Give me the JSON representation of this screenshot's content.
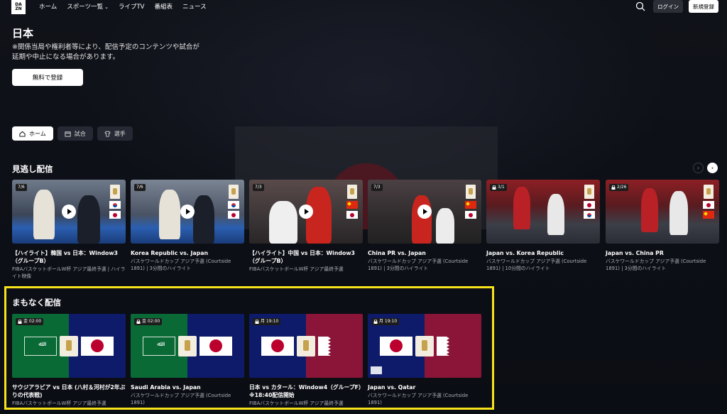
{
  "header": {
    "logo_line1": "DA",
    "logo_line2": "ZN",
    "nav": [
      "ホーム",
      "スポーツ一覧",
      "ライブTV",
      "番組表",
      "ニュース"
    ],
    "login_label": "ログイン",
    "signup_label": "新規登録"
  },
  "page": {
    "title": "日本",
    "notice": "※関係当局や権利者等により、配信予定のコンテンツや試合が延期や中止になる場合があります。",
    "free_signup_label": "無料で登録"
  },
  "tabs": [
    {
      "label": "ホーム",
      "icon": "home-icon",
      "active": true
    },
    {
      "label": "試合",
      "icon": "calendar-icon",
      "active": false
    },
    {
      "label": "選手",
      "icon": "jersey-icon",
      "active": false
    }
  ],
  "catchup": {
    "title": "見逃し配信",
    "cards": [
      {
        "badge": "7/6",
        "title": "【ハイライト】韓国 vs 日本：Window3（グループB）",
        "sub": "FIBAバスケットボールW杯 アジア最終予選 | ハイライト映像",
        "locked": false,
        "play": true
      },
      {
        "badge": "7/6",
        "title": "Korea Republic vs. Japan",
        "sub": "バスケワールドカップ アジア予選 (Courtside 1891) | 3分間のハイライト",
        "locked": false,
        "play": true
      },
      {
        "badge": "7/3",
        "title": "【ハイライト】中国 vs 日本：Window3（グループB）",
        "sub": "FIBAバスケットボールW杯 アジア最終予選",
        "locked": false,
        "play": true
      },
      {
        "badge": "7/3",
        "title": "China PR vs. Japan",
        "sub": "バスケワールドカップ アジア予選 (Courtside 1891) | 3分間のハイライト",
        "locked": false,
        "play": true
      },
      {
        "badge": "3/1",
        "title": "Japan vs. Korea Republic",
        "sub": "バスケワールドカップ アジア予選 (Courtside 1891) | 10分間のハイライト",
        "locked": true,
        "play": false
      },
      {
        "badge": "2/26",
        "title": "Japan vs. China PR",
        "sub": "バスケワールドカップ アジア予選 (Courtside 1891) | 3分間のハイライト",
        "locked": true,
        "play": false
      }
    ]
  },
  "upcoming": {
    "title": "まもなく配信",
    "cards": [
      {
        "badge": "金 02:00",
        "title": "サウジアラビア vs 日本 (八村＆河村が2年ぶりの代表戦)",
        "sub": "FIBAバスケットボールW杯 アジア最終予選"
      },
      {
        "badge": "金 02:00",
        "title": "Saudi Arabia vs. Japan",
        "sub": "バスケワールドカップ アジア予選 (Courtside 1891)"
      },
      {
        "badge": "月 19:10",
        "title": "日本 vs カタール：Window4（グループF）※18:40配信開始",
        "sub": "FIBAバスケットボールW杯 アジア最終予選"
      },
      {
        "badge": "月 19:10",
        "title": "Japan vs. Qatar",
        "sub": "バスケワールドカップ アジア予選 (Courtside 1891)"
      }
    ]
  },
  "colors": {
    "accent_highlight": "#f7e21b",
    "japan_red": "#bc002d",
    "saudi_green": "#0a6a36",
    "navy": "#0e1b6b",
    "qatar_maroon": "#8a1538"
  }
}
